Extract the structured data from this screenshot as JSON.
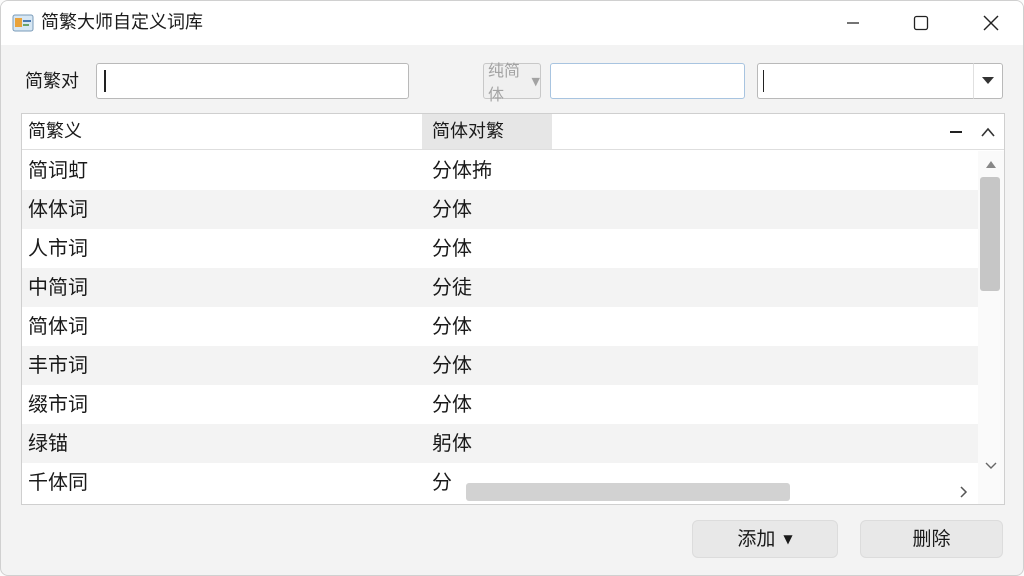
{
  "window": {
    "title": "简繁大师自定义词库"
  },
  "filter": {
    "label": "简繁对",
    "value": "",
    "mode_label": "纯简体",
    "simplified_value": "",
    "traditional_value": ""
  },
  "table": {
    "columns": [
      "简繁义",
      "简体对繁"
    ],
    "rows": [
      [
        "简词虰",
        "分体抪"
      ],
      [
        "体体词",
        "分体"
      ],
      [
        "人市词",
        "分体"
      ],
      [
        "中简词",
        "分徒"
      ],
      [
        "简体词",
        "分体"
      ],
      [
        "丰市词",
        "分体"
      ],
      [
        "缀市词",
        "分体"
      ],
      [
        "绿锚",
        "躬体"
      ],
      [
        "千体同",
        "分"
      ]
    ]
  },
  "buttons": {
    "add": "添加",
    "delete": "删除"
  },
  "icons": {
    "app": "app-icon",
    "minimize": "minimize-icon",
    "maximize": "maximize-icon",
    "close": "close-icon"
  }
}
